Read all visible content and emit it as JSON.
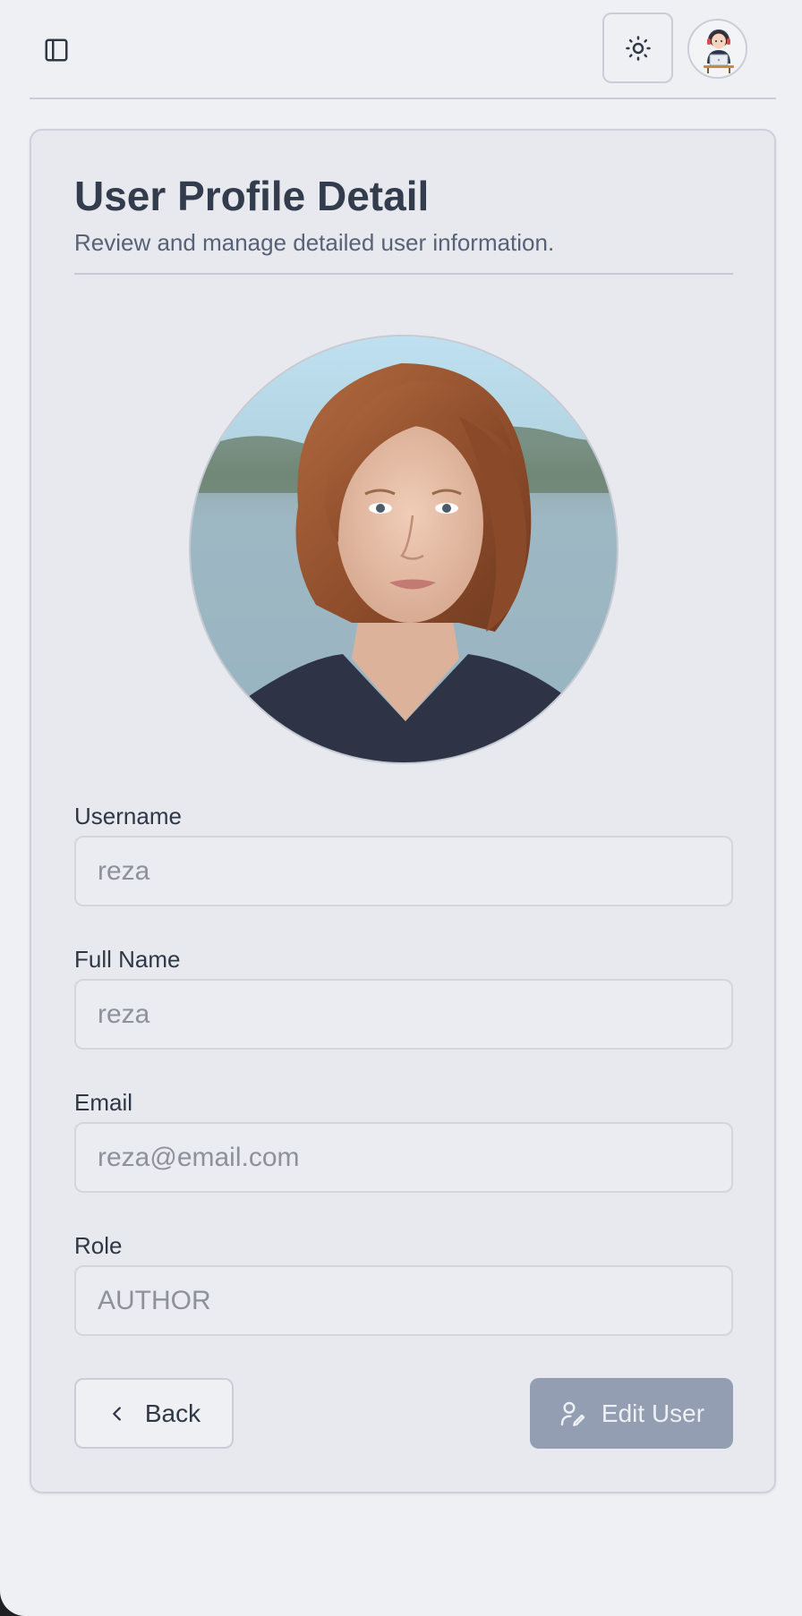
{
  "header": {
    "sidebar_toggle_icon": "sidebar-panel-icon",
    "theme_toggle_icon": "sun-icon",
    "avatar_icon": "user-avatar-illustration"
  },
  "profile": {
    "title": "User Profile Detail",
    "subtitle": "Review and manage detailed user information.",
    "photo_alt": "Profile photo"
  },
  "form": {
    "username": {
      "label": "Username",
      "placeholder": "reza"
    },
    "full_name": {
      "label": "Full Name",
      "placeholder": "reza"
    },
    "email": {
      "label": "Email",
      "placeholder": "reza@email.com"
    },
    "role": {
      "label": "Role",
      "placeholder": "AUTHOR"
    }
  },
  "actions": {
    "back_label": "Back",
    "back_icon": "chevron-left-icon",
    "edit_label": "Edit User",
    "edit_icon": "user-edit-icon"
  },
  "colors": {
    "background": "#eef0f4",
    "card": "#e7e9ef",
    "title": "#333c4d",
    "edit_button": "#939eb3"
  }
}
